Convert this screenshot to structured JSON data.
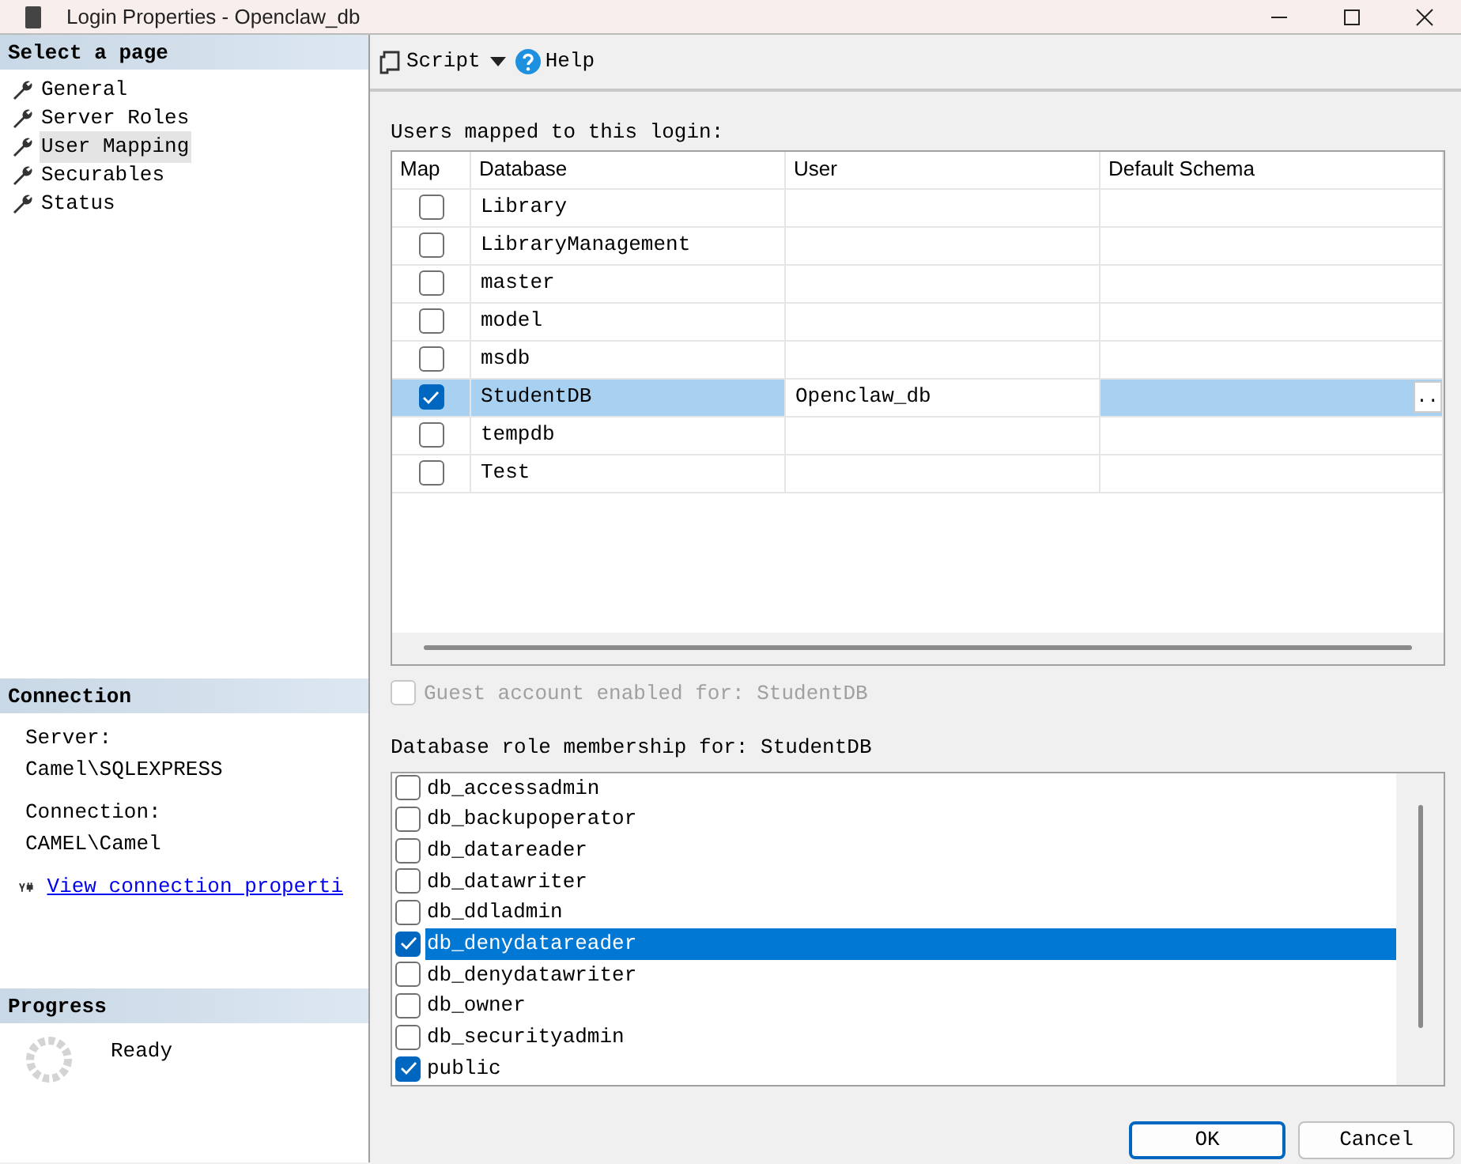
{
  "window": {
    "title": "Login Properties - Openclaw_db"
  },
  "sidebar": {
    "header": "Select a page",
    "items": [
      {
        "label": "General",
        "selected": false
      },
      {
        "label": "Server Roles",
        "selected": false
      },
      {
        "label": "User Mapping",
        "selected": true
      },
      {
        "label": "Securables",
        "selected": false
      },
      {
        "label": "Status",
        "selected": false
      }
    ]
  },
  "connection": {
    "header": "Connection",
    "server_label": "Server:",
    "server": "Camel\\SQLEXPRESS",
    "connection_label": "Connection:",
    "connection": "CAMEL\\Camel",
    "link": "View connection properti"
  },
  "progress": {
    "header": "Progress",
    "status": "Ready"
  },
  "toolbar": {
    "script": "Script",
    "help": "Help"
  },
  "mapping": {
    "label": "Users mapped to this login:",
    "columns": [
      "Map",
      "Database",
      "User",
      "Default Schema"
    ],
    "rows": [
      {
        "checked": false,
        "selected": false,
        "database": "Library"
      },
      {
        "checked": false,
        "selected": false,
        "database": "LibraryManagement"
      },
      {
        "checked": false,
        "selected": false,
        "database": "master"
      },
      {
        "checked": false,
        "selected": false,
        "database": "model"
      },
      {
        "checked": false,
        "selected": false,
        "database": "msdb"
      },
      {
        "checked": true,
        "selected": true,
        "database": "StudentDB",
        "user": "Openclaw_db",
        "browse": ".."
      },
      {
        "checked": false,
        "selected": false,
        "database": "tempdb"
      },
      {
        "checked": false,
        "selected": false,
        "database": "Test"
      }
    ]
  },
  "guest": {
    "label": "Guest account enabled for: StudentDB",
    "checked": false,
    "disabled": true
  },
  "roles": {
    "label": "Database role membership for: StudentDB",
    "items": [
      {
        "name": "db_accessadmin",
        "checked": false,
        "selected": false
      },
      {
        "name": "db_backupoperator",
        "checked": false,
        "selected": false
      },
      {
        "name": "db_datareader",
        "checked": false,
        "selected": false
      },
      {
        "name": "db_datawriter",
        "checked": false,
        "selected": false
      },
      {
        "name": "db_ddladmin",
        "checked": false,
        "selected": false
      },
      {
        "name": "db_denydatareader",
        "checked": true,
        "selected": true
      },
      {
        "name": "db_denydatawriter",
        "checked": false,
        "selected": false
      },
      {
        "name": "db_owner",
        "checked": false,
        "selected": false
      },
      {
        "name": "db_securityadmin",
        "checked": false,
        "selected": false
      },
      {
        "name": "public",
        "checked": true,
        "selected": false
      }
    ]
  },
  "buttons": [
    {
      "label": "OK",
      "default": true
    },
    {
      "label": "Cancel",
      "default": false
    }
  ]
}
